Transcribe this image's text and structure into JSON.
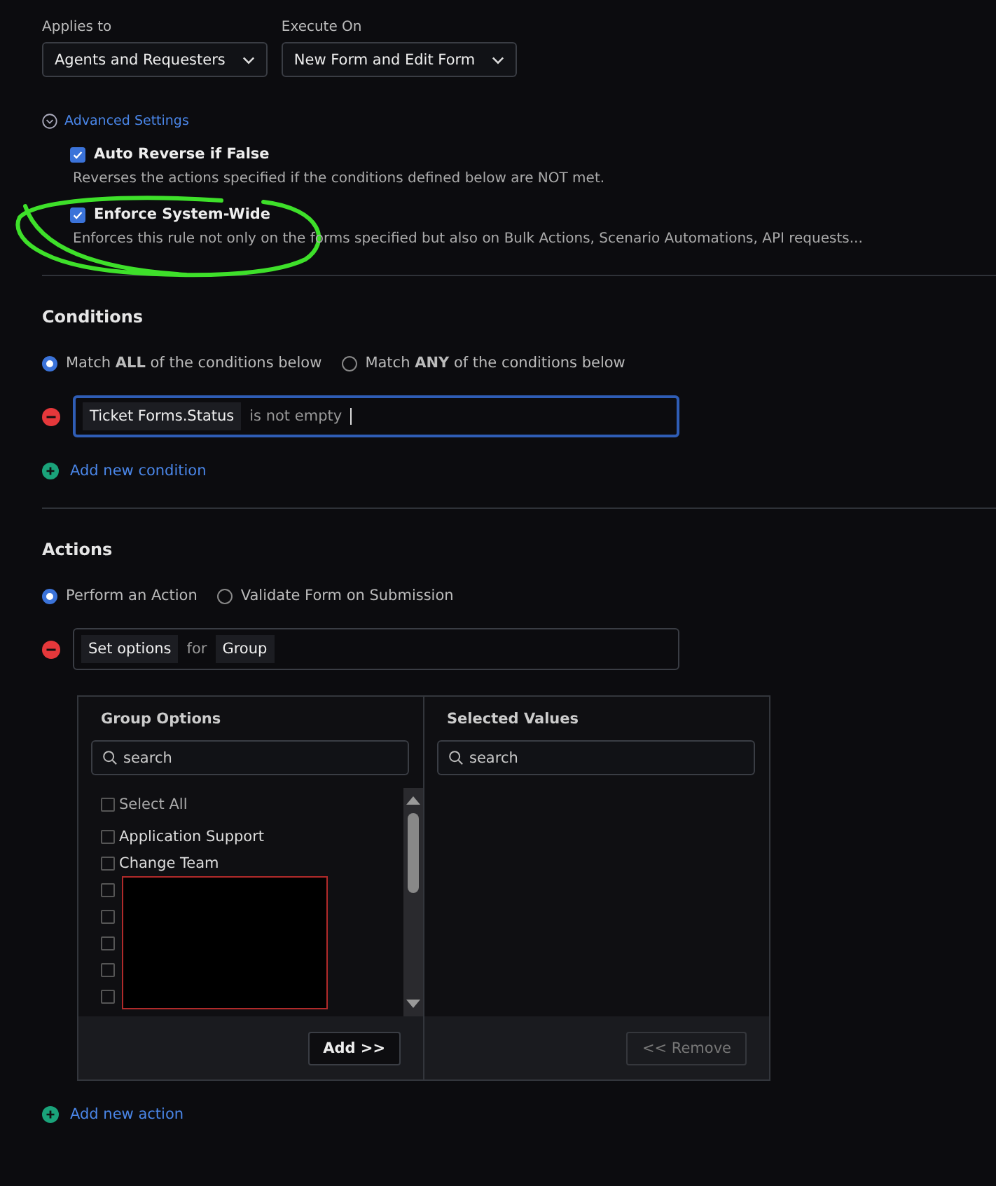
{
  "applies_to": {
    "label": "Applies to",
    "value": "Agents and Requesters"
  },
  "execute_on": {
    "label": "Execute On",
    "value": "New Form and Edit Form"
  },
  "advanced_settings": {
    "label": "Advanced Settings",
    "expanded": true,
    "options": [
      {
        "label": "Auto Reverse if False",
        "checked": true,
        "description": "Reverses the actions specified if the conditions defined below are NOT met."
      },
      {
        "label": "Enforce System-Wide",
        "checked": true,
        "description": "Enforces this rule not only on the forms specified but also on Bulk Actions, Scenario Automations, API requests..."
      }
    ]
  },
  "annotation": {
    "kind": "scribble"
  },
  "conditions": {
    "title": "Conditions",
    "match_options": [
      {
        "label": "Match **ALL** of the conditions below",
        "selected": true
      },
      {
        "label": "Match **ANY** of the conditions below",
        "selected": false
      }
    ],
    "rows": [
      {
        "field": "Ticket Forms.Status",
        "operator": "is not empty"
      }
    ],
    "add_link": "Add new condition"
  },
  "actions": {
    "title": "Actions",
    "mode_options": [
      {
        "label": "Perform an Action",
        "selected": true
      },
      {
        "label": "Validate Form on Submission",
        "selected": false
      }
    ],
    "rows": [
      {
        "action": "Set options",
        "connector": "for",
        "target": "Group"
      }
    ],
    "picker": {
      "left_title": "Group Options",
      "left_search": {
        "placeholder": "search"
      },
      "select_all": {
        "label": "Select All",
        "checked": false
      },
      "options": [
        {
          "label": "Application Support",
          "checked": false
        },
        {
          "label": "Change Team",
          "checked": false
        }
      ],
      "redacted_options": [
        {
          "checked": false
        },
        {
          "checked": false
        },
        {
          "checked": false
        },
        {
          "checked": false
        },
        {
          "checked": false
        }
      ],
      "add_button": "Add >>",
      "right_title": "Selected Values",
      "right_search": {
        "placeholder": "search"
      },
      "remove_button": "<< Remove",
      "remove_disabled": true
    },
    "add_link": "Add new action"
  }
}
